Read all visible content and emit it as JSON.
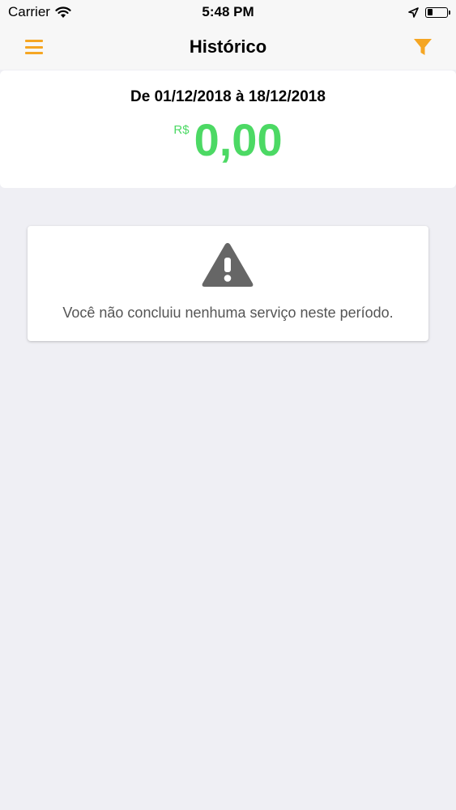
{
  "status_bar": {
    "carrier": "Carrier",
    "time": "5:48 PM",
    "icons": [
      "wifi-icon",
      "location-arrow-icon",
      "battery-icon"
    ]
  },
  "nav": {
    "title": "Histórico",
    "left_icon": "menu-icon",
    "right_icon": "filter-icon",
    "accent_color": "#f5a623"
  },
  "summary": {
    "period_label": "De 01/12/2018 à 18/12/2018",
    "currency": "R$",
    "amount": "0,00",
    "amount_color": "#4cd964"
  },
  "empty_state": {
    "icon": "warning-icon",
    "message": "Você não concluiu nenhuma serviço neste período."
  }
}
